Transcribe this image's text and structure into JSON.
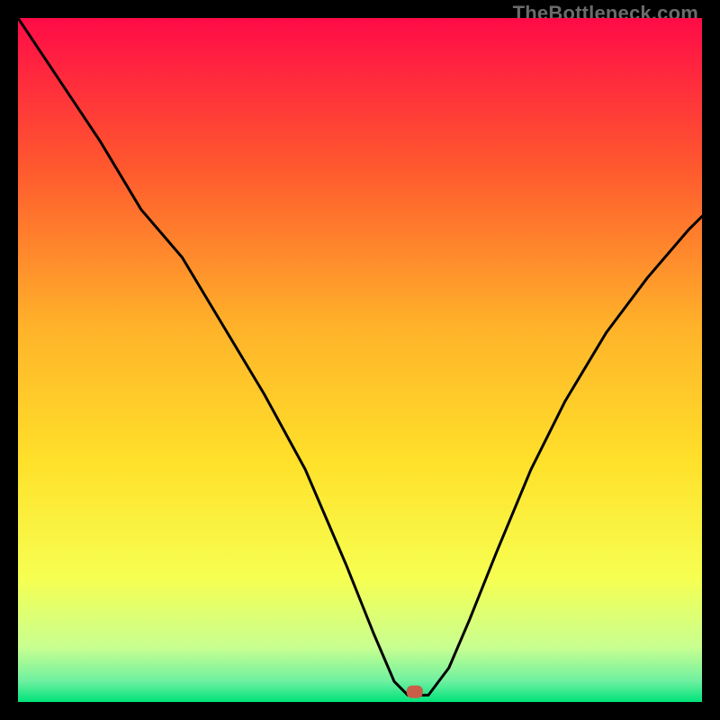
{
  "watermark": "TheBottleneck.com",
  "chart_data": {
    "type": "line",
    "title": "",
    "xlabel": "",
    "ylabel": "",
    "xlim": [
      0,
      100
    ],
    "ylim": [
      0,
      100
    ],
    "grid": false,
    "legend": false,
    "background_gradient": {
      "top_color": "#ff0b47",
      "mid_colors": [
        "#ff7b2a",
        "#ffe12a",
        "#f4ff52",
        "#c2ff9a"
      ],
      "bottom_color": "#00e37a"
    },
    "series": [
      {
        "name": "bottleneck-curve",
        "color": "#000000",
        "x": [
          0,
          6,
          12,
          18,
          24,
          30,
          36,
          42,
          48,
          52,
          55,
          57,
          58,
          60,
          63,
          66,
          70,
          75,
          80,
          86,
          92,
          98,
          100
        ],
        "values": [
          100,
          91,
          82,
          72,
          65,
          55,
          45,
          34,
          20,
          10,
          3,
          1,
          1,
          1,
          5,
          12,
          22,
          34,
          44,
          54,
          62,
          69,
          71
        ]
      }
    ],
    "annotations": [
      {
        "name": "min-marker",
        "shape": "rounded-rect",
        "x": 58,
        "y": 1.5,
        "color": "#c95d47"
      }
    ]
  }
}
